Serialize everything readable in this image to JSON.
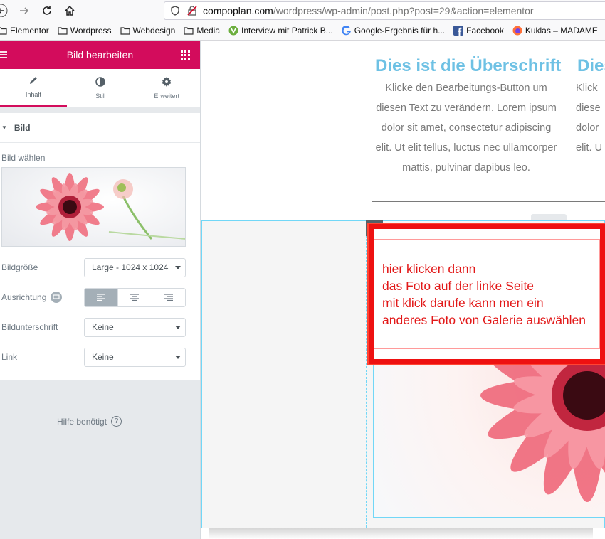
{
  "browser": {
    "url_host": "compoplan.com",
    "url_path": "/wordpress/wp-admin/post.php?post=29&action=elementor",
    "bookmarks": [
      {
        "label": "Elementor",
        "icon": "folder-icon"
      },
      {
        "label": "Wordpress",
        "icon": "folder-icon"
      },
      {
        "label": "Webdesign",
        "icon": "folder-icon"
      },
      {
        "label": "Media",
        "icon": "folder-icon"
      },
      {
        "label": "Interview mit Patrick B...",
        "icon": "v-logo-icon"
      },
      {
        "label": "Google-Ergebnis für h...",
        "icon": "google-icon"
      },
      {
        "label": "Facebook",
        "icon": "facebook-icon"
      },
      {
        "label": "Kuklas – MADAME",
        "icon": "firefox-icon"
      }
    ]
  },
  "panel": {
    "title": "Bild bearbeiten",
    "tabs": [
      {
        "label": "Inhalt",
        "icon": "pencil-icon",
        "active": true
      },
      {
        "label": "Stil",
        "icon": "contrast-icon",
        "active": false
      },
      {
        "label": "Erweitert",
        "icon": "gear-icon",
        "active": false
      }
    ],
    "section_title": "Bild",
    "image_choose_label": "Bild wählen",
    "fields": {
      "size_label": "Bildgröße",
      "size_value": "Large - 1024 x 1024",
      "align_label": "Ausrichtung",
      "caption_label": "Bildunterschrift",
      "caption_value": "Keine",
      "link_label": "Link",
      "link_value": "Keine"
    },
    "help_text": "Hilfe benötigt",
    "colors": {
      "accent": "#d30c5c"
    }
  },
  "preview": {
    "heading": "Dies ist die Überschrift",
    "heading_partial": "Dies",
    "body_lines": [
      "Klicke den Bearbeitungs-Button um",
      "diesen Text zu verändern. Lorem ipsum",
      "dolor sit amet, consectetur adipiscing",
      "elit. Ut elit tellus, luctus nec ullamcorper",
      "mattis, pulvinar dapibus leo."
    ],
    "body_partial_lines": [
      "Klick",
      "diese",
      "dolor",
      "elit. U",
      ""
    ],
    "annotation_lines": [
      "hier klicken  dann",
      "das Foto  auf der linke Seite",
      "mit klick darufe kann men ein",
      "anderes Foto von Galerie auswählen"
    ],
    "colors": {
      "heading": "#6ec1e4",
      "selection": "#71d7f7",
      "annotation": "#ee1111"
    }
  }
}
